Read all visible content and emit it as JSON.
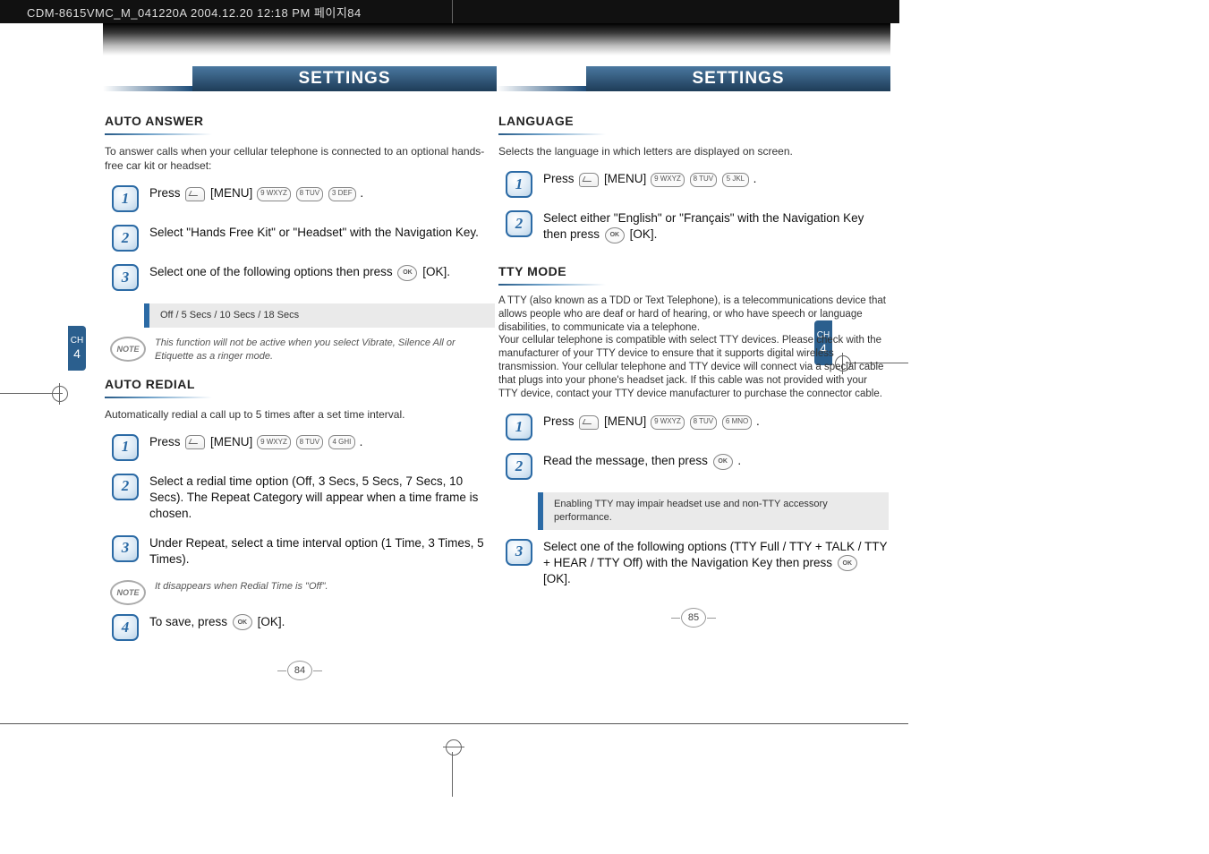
{
  "header_line": "CDM-8615VMC_M_041220A  2004.12.20 12:18 PM  페이지84",
  "title": "SETTINGS",
  "ch_label": "CH",
  "ch_num": "4",
  "page_numbers": {
    "left": "84",
    "right": "85"
  },
  "left": {
    "auto_answer": {
      "heading": "AUTO ANSWER",
      "intro": "To answer calls when your cellular telephone is connected to an optional hands-free car kit or headset:",
      "step1_prefix": "Press",
      "step1_menu": "[MENU]",
      "step1_keys": [
        "9 WXYZ",
        "8 TUV",
        "3 DEF"
      ],
      "step2": "Select \"Hands Free Kit\" or \"Headset\" with the Navigation Key.",
      "step3_a": "Select one of the following options then press",
      "step3_b": "[OK].",
      "options": "Off / 5 Secs / 10 Secs / 18 Secs",
      "note": "This function will not be active when you select Vibrate, Silence All or Etiquette as a ringer mode."
    },
    "auto_redial": {
      "heading": "AUTO REDIAL",
      "intro": "Automatically redial a call up to 5 times after a set time interval.",
      "step1_prefix": "Press",
      "step1_menu": "[MENU]",
      "step1_keys": [
        "9 WXYZ",
        "8 TUV",
        "4 GHI"
      ],
      "step2": "Select a redial time option (Off, 3 Secs, 5 Secs, 7 Secs, 10 Secs). The Repeat Category will appear when a time frame is chosen.",
      "step3": "Under Repeat, select a time interval option (1 Time, 3 Times, 5 Times).",
      "note": "It disappears when Redial Time is \"Off\".",
      "step4_a": "To save, press",
      "step4_b": "[OK]."
    }
  },
  "right": {
    "language": {
      "heading": "LANGUAGE",
      "intro": "Selects the language in which letters are displayed on screen.",
      "step1_prefix": "Press",
      "step1_menu": "[MENU]",
      "step1_keys": [
        "9 WXYZ",
        "8 TUV",
        "5 JKL"
      ],
      "step2_a": "Select either \"English\" or \"Français\" with the Navigation Key then press",
      "step2_b": "[OK]."
    },
    "tty": {
      "heading": "TTY MODE",
      "intro": "A TTY (also known as a TDD or Text Telephone), is a telecommunications device that allows people who are deaf or hard of hearing, or who have speech or language disabilities, to communicate via a telephone.\nYour cellular telephone is compatible with select TTY devices. Please check with the manufacturer of your TTY device to ensure that it supports digital wireless transmission. Your cellular telephone and TTY device will connect via a special cable that plugs into your phone's headset jack. If this cable was not provided with your TTY device, contact your TTY device manufacturer to purchase the connector cable.",
      "step1_prefix": "Press",
      "step1_menu": "[MENU]",
      "step1_keys": [
        "9 WXYZ",
        "8 TUV",
        "6 MNO"
      ],
      "step2_a": "Read the message, then press",
      "step2_period": ".",
      "options": "Enabling TTY may impair headset use and non-TTY accessory performance.",
      "step3_a": "Select one of the following options (TTY Full / TTY + TALK / TTY + HEAR / TTY Off) with the Navigation Key then press",
      "step3_b": "[OK]."
    }
  },
  "note_label": "NOTE",
  "ok_label": "OK"
}
